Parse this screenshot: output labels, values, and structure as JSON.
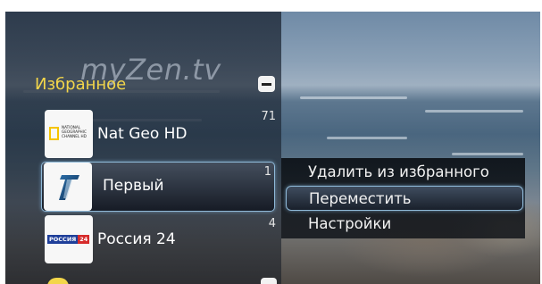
{
  "app": {
    "logo_text": "myZen.tv"
  },
  "favorites": {
    "title": "Избранное",
    "collapse_icon": "minus-icon",
    "channels": [
      {
        "name": "Nat Geo HD",
        "number": "71",
        "logo": "natgeo-logo",
        "logo_text": "NATIONAL GEOGRAPHIC CHANNEL HD"
      },
      {
        "name": "Первый",
        "number": "1",
        "logo": "perviy-logo",
        "selected": true
      },
      {
        "name": "Россия 24",
        "number": "4",
        "logo": "rossiya24-logo",
        "logo_text_blue": "РОССИЯ",
        "logo_text_red": "24"
      }
    ]
  },
  "context_menu": {
    "items": [
      {
        "label": "Удалить из избранного"
      },
      {
        "label": "Переместить",
        "selected": true
      },
      {
        "label": "Настройки"
      }
    ]
  },
  "colors": {
    "accent_yellow": "#f3d64a",
    "focus_border": "#8fb9d8"
  }
}
